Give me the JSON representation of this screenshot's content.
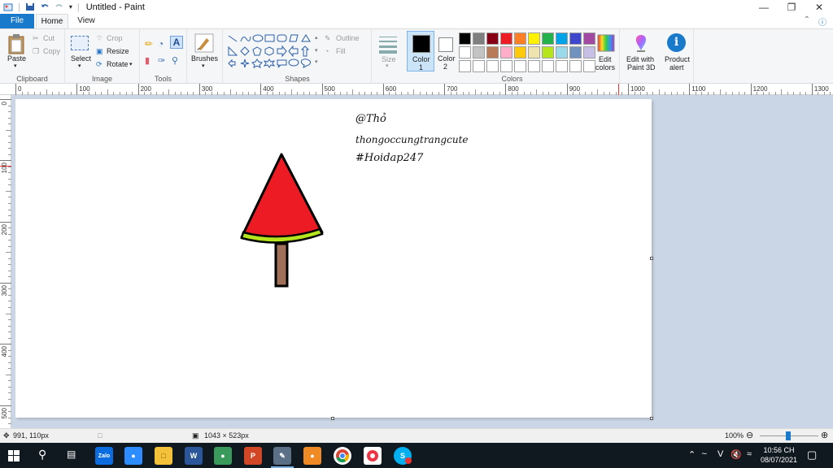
{
  "window": {
    "title": "Untitled - Paint",
    "minimize_icon": "minimize-icon",
    "maximize_icon": "restore-icon",
    "close_icon": "close-icon"
  },
  "tabs": {
    "file": "File",
    "home": "Home",
    "view": "View"
  },
  "ribbon": {
    "clipboard": {
      "paste": "Paste",
      "cut": "Cut",
      "copy": "Copy",
      "label": "Clipboard"
    },
    "image": {
      "select": "Select",
      "crop": "Crop",
      "resize": "Resize",
      "rotate": "Rotate",
      "label": "Image"
    },
    "tools": {
      "label": "Tools"
    },
    "brushes": {
      "label": "Brushes"
    },
    "shapes": {
      "outline": "Outline",
      "fill": "Fill",
      "label": "Shapes"
    },
    "size": {
      "label": "Size"
    },
    "color1": {
      "label": "Color",
      "num": "1"
    },
    "color2": {
      "label": "Color",
      "num": "2"
    },
    "colors": {
      "label": "Colors",
      "edit_line1": "Edit",
      "edit_line2": "colors",
      "palette": [
        "#000000",
        "#7f7f7f",
        "#880015",
        "#ed1c24",
        "#ff7f27",
        "#fff200",
        "#22b14c",
        "#00a2e8",
        "#3f48cc",
        "#a349a4",
        "#ffffff",
        "#c3c3c3",
        "#b97a57",
        "#ffaec9",
        "#ffc90e",
        "#efe4b0",
        "#b5e61d",
        "#99d9ea",
        "#7092be",
        "#c8bfe7",
        "#ffffff",
        "#ffffff",
        "#ffffff",
        "#ffffff",
        "#ffffff",
        "#ffffff",
        "#ffffff",
        "#ffffff",
        "#ffffff",
        "#ffffff"
      ]
    },
    "paint3d": {
      "line1": "Edit with",
      "line2": "Paint 3D"
    },
    "alert": {
      "line1": "Product",
      "line2": "alert"
    }
  },
  "ruler_top": [
    "0",
    "100",
    "200",
    "300",
    "400",
    "500",
    "600",
    "700",
    "800",
    "900",
    "1000",
    "1100",
    "1200",
    "1300"
  ],
  "ruler_left": [
    "0",
    "100",
    "200",
    "300",
    "400",
    "500"
  ],
  "canvas": {
    "text_line1": "@Thỏ",
    "text_line2": "thongoccungtrangcute",
    "text_line3": "#Hoidap247",
    "accent_red": "#ed1c24",
    "accent_green": "#b5e61d",
    "stick_brown": "#a0705a"
  },
  "statusbar": {
    "cursor": "991, 110px",
    "size": "1043 × 523px",
    "zoom": "100%"
  },
  "taskbar": {
    "apps": [
      "start-icon",
      "search-icon",
      "task-view-icon",
      "zalo-icon",
      "zoom-icon",
      "file-explorer-icon",
      "word-icon",
      "app-icon",
      "powerpoint-icon",
      "paint-icon",
      "app-orange-icon",
      "chrome-icon",
      "app-chrome-icon",
      "skype-icon"
    ],
    "zalo": "Zalo",
    "word": "W",
    "ppt": "P",
    "lang": "V",
    "time": "10:56 CH",
    "date": "08/07/2021"
  }
}
